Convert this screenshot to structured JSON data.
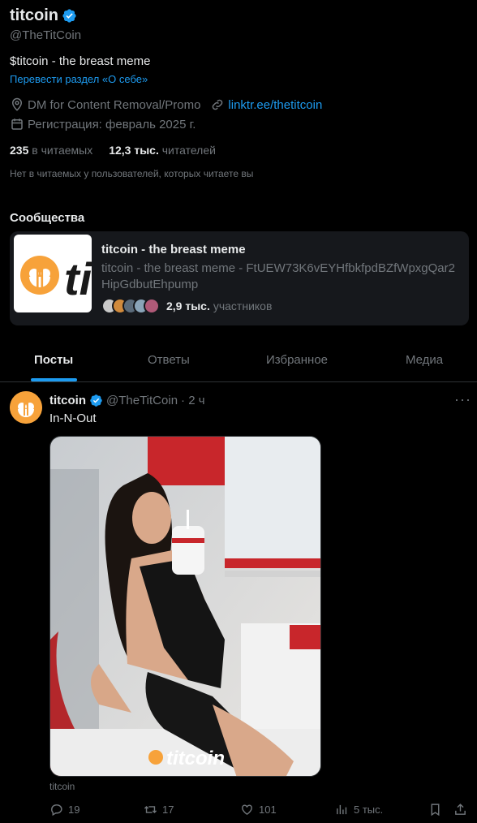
{
  "profile": {
    "name": "titcoin",
    "handle": "@TheTitCoin",
    "bio": "$titcoin - the breast meme",
    "translate_bio": "Перевести раздел «О себе»",
    "location": "DM for Content Removal/Promo",
    "link": "linktr.ee/thetitcoin",
    "joined": "Регистрация: февраль 2025 г.",
    "following_count": "235",
    "following_label": "в читаемых",
    "followers_count": "12,3 тыс.",
    "followers_label": "читателей",
    "no_followers_note": "Нет в читаемых у пользователей, которых читаете вы"
  },
  "communities": {
    "title": "Сообщества",
    "card": {
      "name": "titcoin - the breast meme",
      "description": "titcoin - the breast meme - FtUEW73K6vEYHfbkfpdBZfWpxgQar2HipGdbutEhpump",
      "members_count": "2,9 тыс.",
      "members_label": "участников",
      "thumb_text": "ti"
    }
  },
  "tabs": [
    {
      "label": "Посты",
      "active": true
    },
    {
      "label": "Ответы"
    },
    {
      "label": "Избранное"
    },
    {
      "label": "Медиа"
    }
  ],
  "post": {
    "author": "titcoin",
    "handle": "@TheTitCoin",
    "time": "· 2 ч",
    "more": "···",
    "text": "In-N-Out",
    "watermark": "titcoin",
    "caption": "titcoin",
    "replies": "19",
    "reposts": "17",
    "likes": "101",
    "views": "5 тыс."
  },
  "colors": {
    "accent": "#1d9bf0",
    "brand_orange": "#f7a23a",
    "background": "#000000",
    "muted_text": "#71767b"
  },
  "icons": [
    "verified-badge-icon",
    "location-icon",
    "link-icon",
    "calendar-icon",
    "more-icon",
    "reply-icon",
    "repost-icon",
    "like-icon",
    "views-icon",
    "bookmark-icon",
    "share-icon"
  ]
}
